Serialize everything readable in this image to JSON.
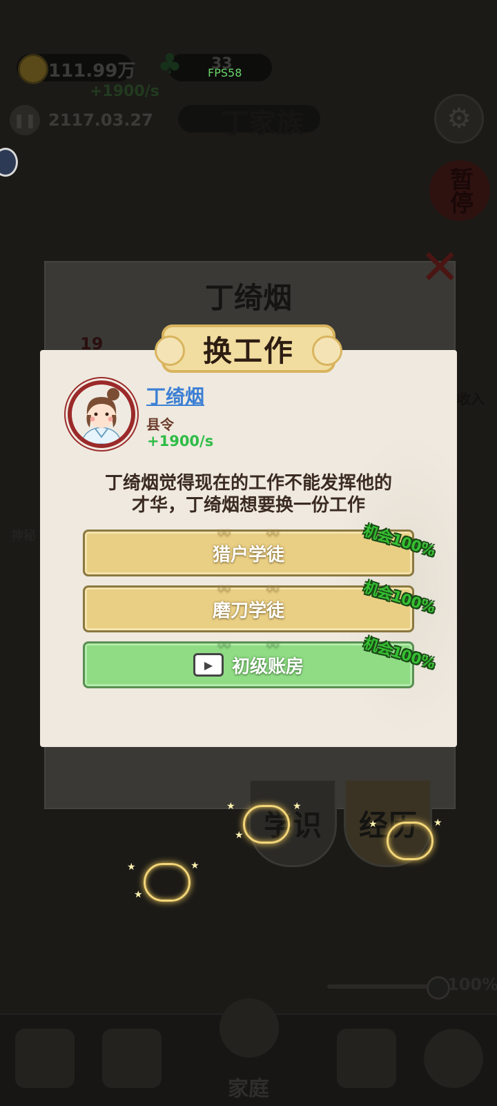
{
  "hud": {
    "coins": "111.99万",
    "coin_rate": "+1900/s",
    "population": "33",
    "fps": "FPS58",
    "date": "2117.03.27",
    "family_name": "丁家族",
    "round_badge": "zz",
    "pause_seal": "暂停"
  },
  "back_panel": {
    "title": "丁绮烟",
    "level": "19",
    "side_label_right": "收入",
    "side_label_left": "神秘"
  },
  "dialog": {
    "title": "换工作",
    "person": {
      "name": "丁绮烟",
      "job": "县令",
      "income": "+1900/s"
    },
    "description_line1": "丁绮烟觉得现在的工作不能发挥他的",
    "description_line2": "才华，丁绮烟想要换一份工作",
    "options": [
      {
        "label": "猎户学徒",
        "chance": "机会100%",
        "style": "gold",
        "icon": ""
      },
      {
        "label": "磨刀学徒",
        "chance": "机会100%",
        "style": "gold",
        "icon": ""
      },
      {
        "label": "初级账房",
        "chance": "机会100%",
        "style": "green",
        "icon": "video-icon"
      }
    ]
  },
  "cards": {
    "left": "学识",
    "right": "经历"
  },
  "bottom": {
    "home_label": "家庭",
    "volume_pct": "100%"
  },
  "colors": {
    "name_link": "#3b7fd4",
    "income_green": "#2ebc46",
    "gold_button": "#e9cf84",
    "green_button": "#90dc85",
    "chance_green": "#35c032"
  }
}
